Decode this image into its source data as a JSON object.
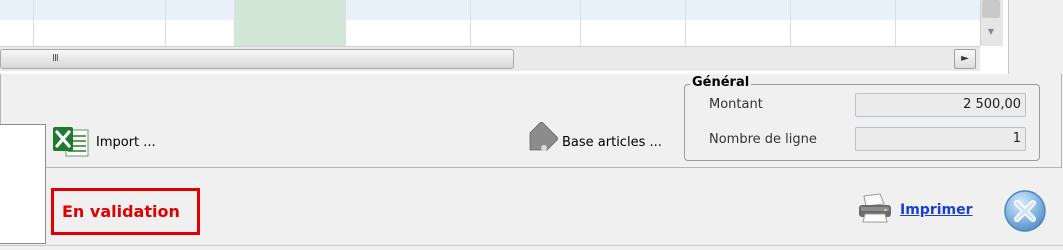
{
  "grid": {
    "hscroll_grip": "III",
    "vscroll_arrow": "▼",
    "hscroll_right_arrow": "►"
  },
  "toolbar": {
    "import_label": "Import ...",
    "base_articles_label": "Base articles ..."
  },
  "general": {
    "legend": "Général",
    "montant_label": "Montant",
    "montant_value": "2 500,00",
    "lignes_label": "Nombre de ligne",
    "lignes_value": "1"
  },
  "status": {
    "text": "En validation",
    "color": "#e00000"
  },
  "actions": {
    "print_label": "Imprimer"
  },
  "icons": {
    "import": "excel-icon",
    "base_articles": "tag-icon",
    "print": "printer-icon",
    "close": "close-icon"
  }
}
